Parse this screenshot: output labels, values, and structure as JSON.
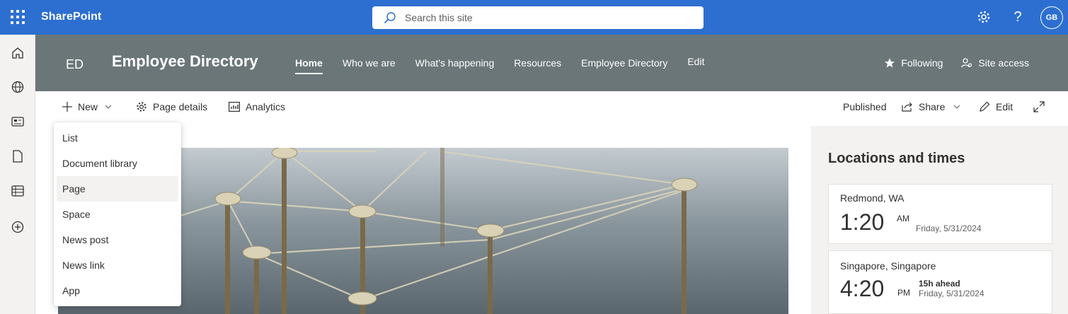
{
  "suite": {
    "brand": "SharePoint",
    "search_placeholder": "Search this site",
    "user_initials": "GB"
  },
  "site": {
    "logo": "ED",
    "title": "Employee Directory",
    "nav": [
      "Home",
      "Who we are",
      "What's happening",
      "Resources",
      "Employee Directory"
    ],
    "nav_edit": "Edit",
    "following": "Following",
    "site_access": "Site access"
  },
  "command": {
    "new": "New",
    "page_details": "Page details",
    "analytics": "Analytics",
    "published": "Published",
    "share": "Share",
    "edit": "Edit"
  },
  "new_menu": [
    "List",
    "Document library",
    "Page",
    "Space",
    "News post",
    "News link",
    "App"
  ],
  "locations": {
    "title": "Locations and times",
    "cards": [
      {
        "city": "Redmond, WA",
        "time": "1:20",
        "ampm": "AM",
        "ahead": "",
        "date": "Friday, 5/31/2024"
      },
      {
        "city": "Singapore, Singapore",
        "time": "4:20",
        "ampm": "PM",
        "ahead": "15h ahead",
        "date": "Friday, 5/31/2024"
      }
    ]
  },
  "icons": {
    "app_bar": [
      "home-icon",
      "globe-icon",
      "news-icon",
      "file-icon",
      "list-icon",
      "add-circle-icon"
    ]
  },
  "colors": {
    "suite_bar": "#2d6fd0",
    "site_header": "#6b7678",
    "panel": "#f3f2f1"
  }
}
